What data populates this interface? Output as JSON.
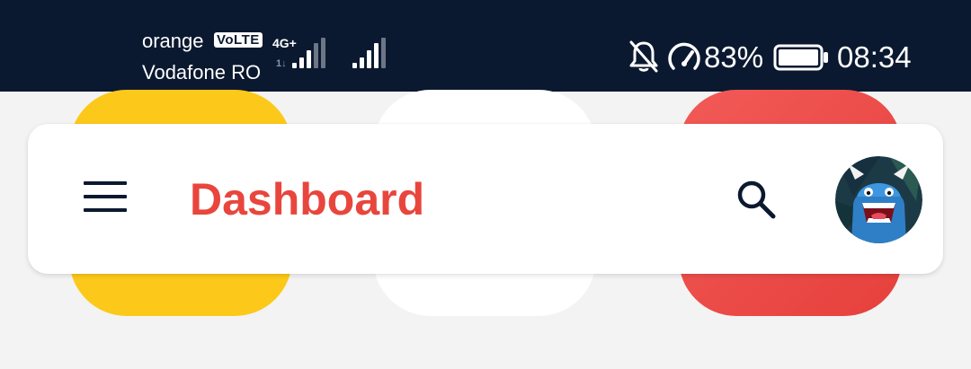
{
  "status_bar": {
    "carrier_primary": "orange",
    "volte_badge": "VoLTE",
    "carrier_secondary": "Vodafone RO",
    "network_type": "4G+",
    "battery_percent": "83%",
    "time": "08:34",
    "icons": [
      "signal-icon",
      "mute-notifications-icon",
      "speed-icon",
      "battery-icon"
    ]
  },
  "app_bar": {
    "title": "Dashboard",
    "icons": [
      "menu-icon",
      "search-icon",
      "avatar"
    ]
  },
  "colors": {
    "status_bar_bg": "#0b1930",
    "title": "#e8463d",
    "tile_yellow": "#fcc91a",
    "tile_white": "#ffffff",
    "tile_red": "#e6403c",
    "background": "#f3f3f3"
  }
}
